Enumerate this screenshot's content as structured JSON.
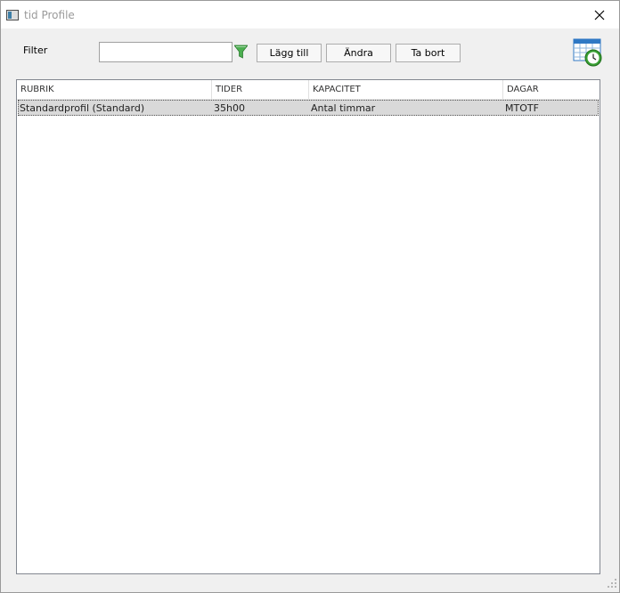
{
  "window": {
    "title": "tid Profile"
  },
  "toolbar": {
    "filter_label": "Filter",
    "filter_value": "",
    "add_label": "Lägg till",
    "edit_label": "Ändra",
    "delete_label": "Ta bort"
  },
  "icons": {
    "app": "app-window-icon",
    "close": "close-icon",
    "filter": "funnel-icon",
    "calendar": "calendar-clock-icon"
  },
  "colors": {
    "filter_icon": "#4caf50",
    "calendar_blue": "#2f78c4",
    "clock_green": "#3aa035",
    "selected_row": "#d9d9d9"
  },
  "table": {
    "columns": [
      "RUBRIK",
      "TIDER",
      "KAPACITET",
      "DAGAR"
    ],
    "rows": [
      {
        "rubrik": "Standardprofil (Standard)",
        "tider": "35h00",
        "kapacitet": "Antal timmar",
        "dagar": "MTOTF"
      }
    ]
  }
}
